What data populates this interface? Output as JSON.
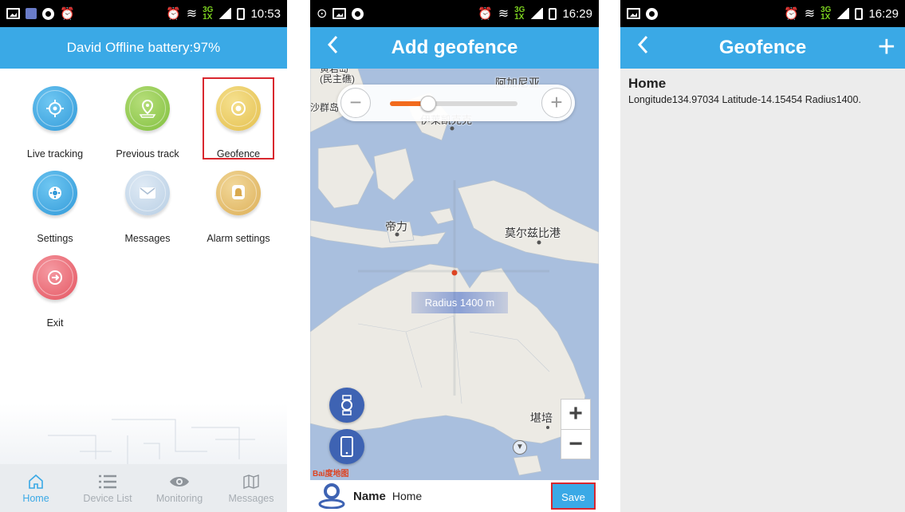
{
  "phone1": {
    "status_time": "10:53",
    "header_title": "David Offline battery:97%",
    "tiles": [
      {
        "label": "Live tracking",
        "icon": "crosshair-icon",
        "color": "#3aa0e0"
      },
      {
        "label": "Previous track",
        "icon": "map-pin-icon",
        "color": "#8cc84b"
      },
      {
        "label": "Geofence",
        "icon": "target-icon",
        "color": "#e8c55a"
      },
      {
        "label": "Settings",
        "icon": "gear-icon",
        "color": "#3aa0e0"
      },
      {
        "label": "Messages",
        "icon": "envelope-icon",
        "color": "#c3d6ea"
      },
      {
        "label": "Alarm settings",
        "icon": "bell-icon",
        "color": "#e0b866"
      },
      {
        "label": "Exit",
        "icon": "exit-icon",
        "color": "#e8606b"
      }
    ],
    "tabs": [
      {
        "label": "Home",
        "icon": "home-icon",
        "active": true
      },
      {
        "label": "Device List",
        "icon": "list-icon",
        "active": false
      },
      {
        "label": "Monitoring",
        "icon": "eye-icon",
        "active": false
      },
      {
        "label": "Messages",
        "icon": "map-icon",
        "active": false
      }
    ]
  },
  "phone2": {
    "status_time": "16:29",
    "title": "Add geofence",
    "zoom_minus": "−",
    "zoom_plus": "+",
    "zoom_level": 0.3,
    "map_labels": {
      "top_left": "黄岩岛\n(民主礁)",
      "top_left2": "沙群岛",
      "top_right": "阿加尼亚",
      "center_top": "伊莱凯克克",
      "dili": "帝力",
      "port_moresby": "莫尔兹比港",
      "hobart": "堪培"
    },
    "radius_label": "Radius 1400 m",
    "map_zoom_in": "+",
    "map_zoom_out": "−",
    "baidu_logo": "Bai度地图",
    "name_label": "Name",
    "name_value": "Home",
    "save_label": "Save"
  },
  "phone3": {
    "status_time": "16:29",
    "title": "Geofence",
    "add_label": "+",
    "items": [
      {
        "name": "Home",
        "detail": "Longitude134.97034  Latitude-14.15454  Radius1400."
      }
    ]
  },
  "colors": {
    "accent": "#3aa9e6",
    "highlight": "#d9272e",
    "slider": "#f26b1d"
  }
}
